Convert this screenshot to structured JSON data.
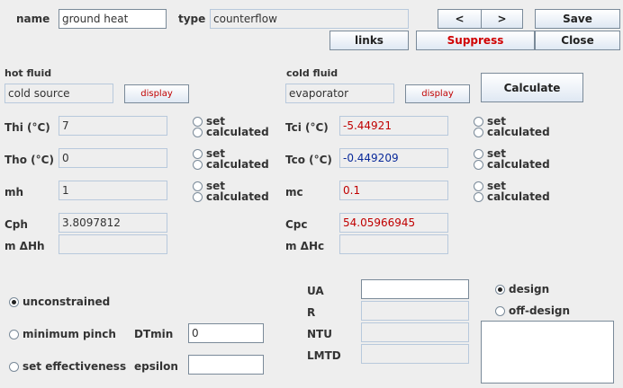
{
  "header": {
    "name_label": "name",
    "name_value": "ground heat",
    "type_label": "type",
    "type_value": "counterflow",
    "prev_label": "<",
    "next_label": ">",
    "save_label": "Save",
    "links_label": "links",
    "suppress_label": "Suppress",
    "close_label": "Close"
  },
  "hot": {
    "title": "hot fluid",
    "source": "cold source",
    "display_label": "display",
    "thi_label": "Thi (°C)",
    "thi_value": "7",
    "tho_label": "Tho (°C)",
    "tho_value": "0",
    "mh_label": "mh",
    "mh_value": "1",
    "cph_label": "Cph",
    "cph_value": "3.8097812",
    "mdh_label": "m ΔHh",
    "mdh_value": ""
  },
  "cold": {
    "title": "cold fluid",
    "source": "evaporator",
    "display_label": "display",
    "tci_label": "Tci (°C)",
    "tci_value": "-5.44921",
    "tco_label": "Tco (°C)",
    "tco_value": "-0.449209",
    "mc_label": "mc",
    "mc_value": "0.1",
    "cpc_label": "Cpc",
    "cpc_value": "54.05966945",
    "mdh_label": "m ΔHc",
    "mdh_value": ""
  },
  "radio": {
    "set": "set",
    "calculated": "calculated"
  },
  "calculate_label": "Calculate",
  "constraints": {
    "unconstrained": "unconstrained",
    "min_pinch": "minimum pinch",
    "dtmin_label": "DTmin",
    "dtmin_value": "0",
    "set_eff": "set effectiveness",
    "epsilon_label": "epsilon",
    "epsilon_value": ""
  },
  "results": {
    "ua_label": "UA",
    "ua_value": "",
    "r_label": "R",
    "r_value": "",
    "ntu_label": "NTU",
    "ntu_value": "",
    "lmtd_label": "LMTD",
    "lmtd_value": ""
  },
  "mode": {
    "design": "design",
    "off_design": "off-design"
  }
}
